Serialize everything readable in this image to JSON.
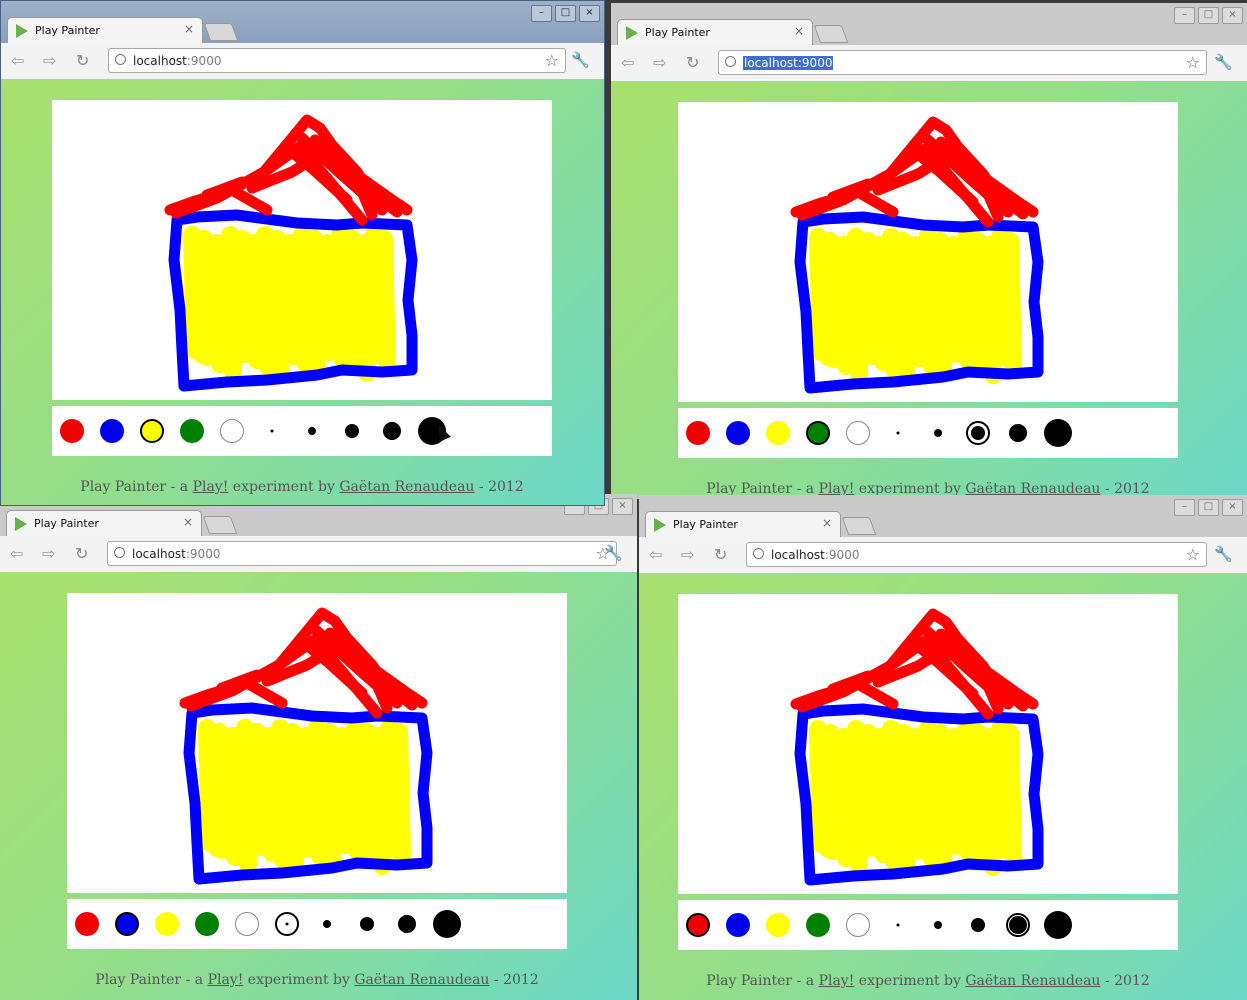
{
  "app": {
    "tab_title": "Play Painter",
    "url_host": "localhost",
    "url_port": ":9000",
    "min_glyph": "–",
    "max_glyph": "□",
    "close_glyph": "×",
    "tab_close_glyph": "×"
  },
  "footer": {
    "prefix": "Play Painter - a ",
    "link1": "Play!",
    "middle": " experiment by ",
    "link2": "Gaëtan Renaudeau",
    "suffix": " - 2012"
  },
  "palette": {
    "colors": [
      "#ee0000",
      "#0000ee",
      "#ffff00",
      "#008000",
      "#ffffff"
    ],
    "brush_sizes": [
      3,
      8,
      14,
      18,
      28
    ]
  },
  "drawing": {
    "roof_color": "#ff0000",
    "walls_color": "#0000ff",
    "fill_color": "#ffff00"
  },
  "windows": [
    {
      "selected_color": 2,
      "selected_size": 4,
      "url_selected": false,
      "active": true
    },
    {
      "selected_color": 3,
      "selected_size": 2,
      "url_selected": true,
      "active": false
    },
    {
      "selected_color": 1,
      "selected_size": 0,
      "url_selected": false,
      "active": false
    },
    {
      "selected_color": 0,
      "selected_size": 3,
      "url_selected": false,
      "active": false
    }
  ]
}
